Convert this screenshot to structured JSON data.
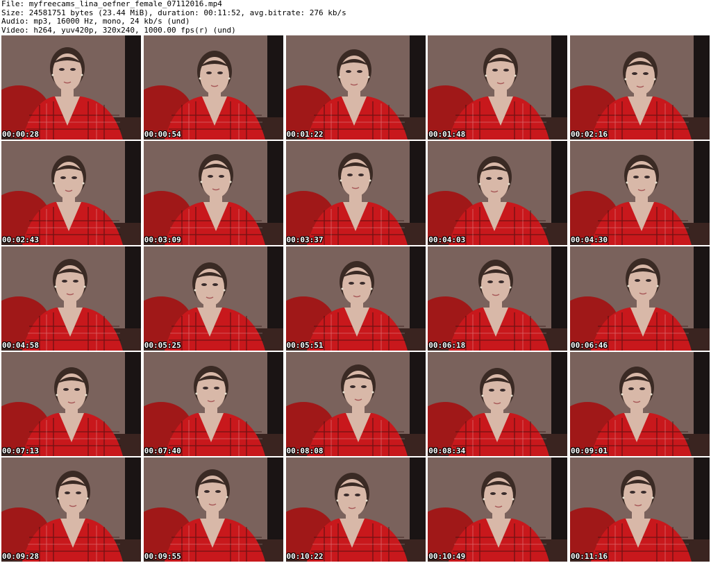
{
  "header": {
    "file": "File: myfreecams_lina_oefner_female_07112016.mp4",
    "size": "Size: 24581751 bytes (23.44 MiB), duration: 00:11:52, avg.bitrate: 276 kb/s",
    "audio": "Audio: mp3, 16000 Hz, mono, 24 kb/s (und)",
    "video": "Video: h264, yuv420p, 320x240, 1000.00 fps(r) (und)"
  },
  "thumbnails": [
    {
      "timestamp": "00:00:28"
    },
    {
      "timestamp": "00:00:54"
    },
    {
      "timestamp": "00:01:22"
    },
    {
      "timestamp": "00:01:48"
    },
    {
      "timestamp": "00:02:16"
    },
    {
      "timestamp": "00:02:43"
    },
    {
      "timestamp": "00:03:09"
    },
    {
      "timestamp": "00:03:37"
    },
    {
      "timestamp": "00:04:03"
    },
    {
      "timestamp": "00:04:30"
    },
    {
      "timestamp": "00:04:58"
    },
    {
      "timestamp": "00:05:25"
    },
    {
      "timestamp": "00:05:51"
    },
    {
      "timestamp": "00:06:18"
    },
    {
      "timestamp": "00:06:46"
    },
    {
      "timestamp": "00:07:13"
    },
    {
      "timestamp": "00:07:40"
    },
    {
      "timestamp": "00:08:08"
    },
    {
      "timestamp": "00:08:34"
    },
    {
      "timestamp": "00:09:01"
    },
    {
      "timestamp": "00:09:28"
    },
    {
      "timestamp": "00:09:55"
    },
    {
      "timestamp": "00:10:22"
    },
    {
      "timestamp": "00:10:49"
    },
    {
      "timestamp": "00:11:16"
    }
  ],
  "colors": {
    "wall": "#7a625c",
    "shirt": "#c8181c",
    "chair": "#a01818",
    "skin": "#d8b8a8",
    "hair": "#3a2a24",
    "dark_edge": "#1a1414",
    "timestamp_text": "#ffffff"
  }
}
